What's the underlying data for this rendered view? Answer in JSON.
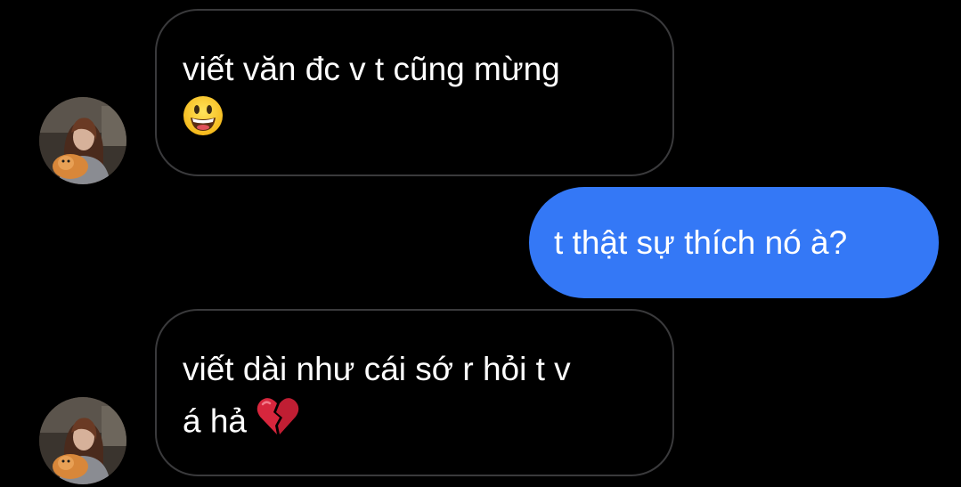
{
  "conversation": {
    "messages": [
      {
        "direction": "incoming",
        "lines": [
          "viết văn đc v t cũng mừng",
          ""
        ],
        "emoji": "grinning-face-icon"
      },
      {
        "direction": "outgoing",
        "lines": [
          "t thật sự thích nó à?"
        ]
      },
      {
        "direction": "incoming",
        "lines": [
          "viết dài như cái sớ r hỏi t v",
          "á hả"
        ],
        "emoji": "broken-heart-icon"
      }
    ]
  },
  "colors": {
    "background": "#000000",
    "incoming_border": "#3a3a3c",
    "outgoing_bubble": "#3478f6",
    "text": "#ffffff"
  }
}
